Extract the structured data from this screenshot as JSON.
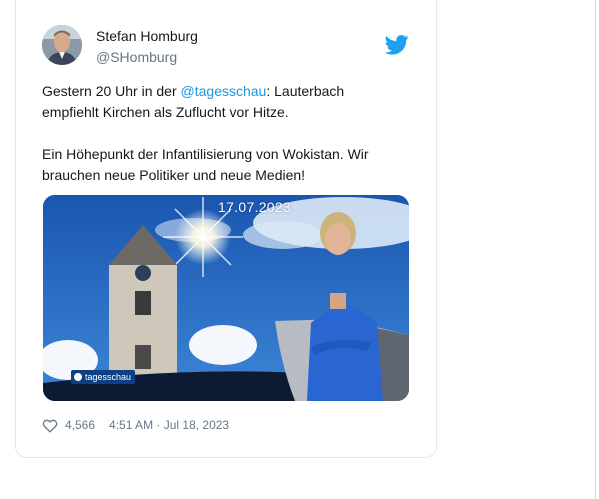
{
  "tweet": {
    "author_name": "Stefan Homburg",
    "author_handle": "@SHomburg",
    "text_prefix": "Gestern 20 Uhr in der ",
    "mention": "@tagesschau",
    "text_suffix": ": Lauterbach empfiehlt Kirchen als Zuflucht vor Hitze.",
    "text_second": "Ein Höhepunkt der Infantilisierung von Wokistan. Wir brauchen neue Politiker und neue Medien!",
    "media": {
      "date_overlay": "17.07.2023",
      "broadcaster_logo": "tagesschau"
    },
    "like_count": "4,566",
    "timestamp": "4:51 AM · Jul 18, 2023"
  },
  "icons": {
    "platform": "twitter-bird-icon",
    "like": "heart-icon"
  },
  "colors": {
    "link": "#1b95e0",
    "brand": "#1da1f2",
    "meta_text": "#657786",
    "card_border": "#e1e8ed"
  }
}
